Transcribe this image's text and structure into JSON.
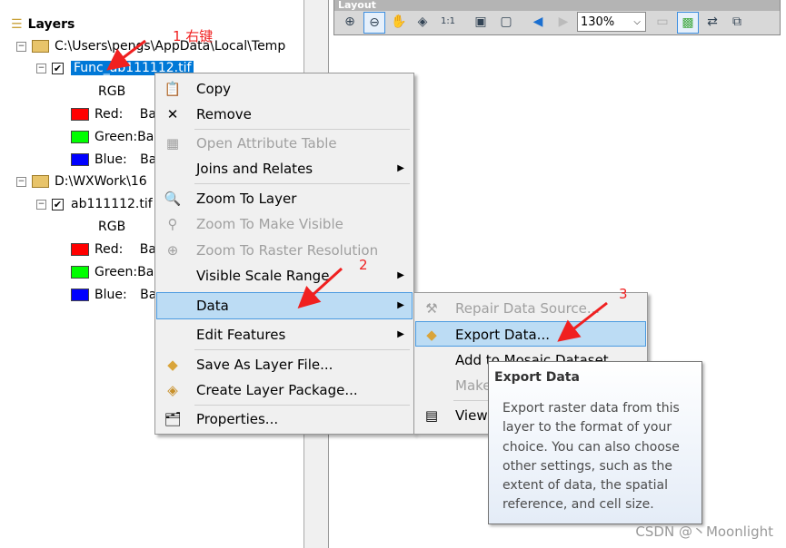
{
  "toc": {
    "root": "Layers",
    "groups": [
      {
        "path": "C:\\Users\\pengs\\AppData\\Local\\Temp",
        "layer": "Func_ab111112.tif",
        "renderer": "RGB",
        "bands": [
          {
            "label": "Red:",
            "value": "Ba",
            "color": "#ff0000"
          },
          {
            "label": "Green:",
            "value": "Ba",
            "color": "#00ff00"
          },
          {
            "label": "Blue:",
            "value": "Ba",
            "color": "#0000ff"
          }
        ]
      },
      {
        "path": "D:\\WXWork\\16",
        "layer": "ab111112.tif",
        "renderer": "RGB",
        "bands": [
          {
            "label": "Red:",
            "value": "Ba",
            "color": "#ff0000"
          },
          {
            "label": "Green:",
            "value": "Ba",
            "color": "#00ff00"
          },
          {
            "label": "Blue:",
            "value": "Ba",
            "color": "#0000ff"
          }
        ]
      }
    ]
  },
  "toolbar": {
    "title": "Layout",
    "zoom": "130%"
  },
  "context_menu": {
    "items": [
      {
        "label": "Copy",
        "icon": "copy-icon"
      },
      {
        "label": "Remove",
        "icon": "remove-icon"
      },
      {
        "label": "Open Attribute Table",
        "icon": "table-icon",
        "disabled": true
      },
      {
        "label": "Joins and Relates",
        "submenu": true
      },
      {
        "label": "Zoom To Layer",
        "icon": "zoom-layer-icon"
      },
      {
        "label": "Zoom To Make Visible",
        "disabled": true
      },
      {
        "label": "Zoom To Raster Resolution",
        "disabled": true
      },
      {
        "label": "Visible Scale Range",
        "submenu": true
      },
      {
        "label": "Data",
        "submenu": true,
        "highlighted": true
      },
      {
        "label": "Edit Features",
        "submenu": true
      },
      {
        "label": "Save As Layer File..."
      },
      {
        "label": "Create Layer Package..."
      },
      {
        "label": "Properties..."
      }
    ]
  },
  "submenu": {
    "items": [
      {
        "label": "Repair Data Source...",
        "disabled": true
      },
      {
        "label": "Export Data...",
        "highlighted": true
      },
      {
        "label": "Add to Mosaic Dataset"
      },
      {
        "label": "Make",
        "disabled": true
      },
      {
        "label": "View"
      }
    ]
  },
  "tooltip": {
    "title": "Export Data",
    "lines": [
      "Export raster data from this",
      "layer to the format of your",
      "choice. You can also choose",
      "other settings, such as the",
      "extent of data, the spatial",
      "reference, and cell size."
    ]
  },
  "annotations": {
    "step1": "1 右键",
    "step2": "2",
    "step3": "3",
    "color": "#f02020"
  },
  "watermark": "CSDN @丶Moonlight"
}
